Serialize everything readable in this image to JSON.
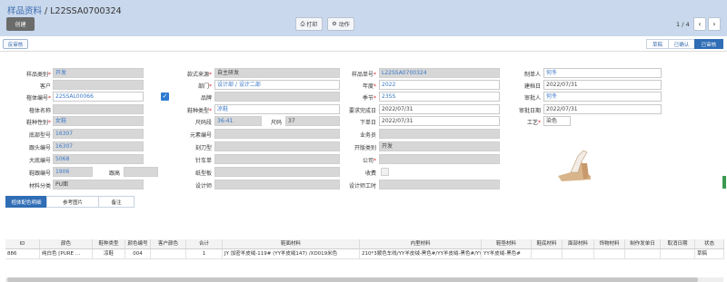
{
  "header": {
    "crumb_link": "样品资料",
    "crumb_sep": " / ",
    "record_no": "L22SSA0700324",
    "create_label": "创建",
    "print_label": "打印",
    "action_label": "动作",
    "pager_text": "1 / 4",
    "prev": "‹",
    "next": "›"
  },
  "status": {
    "unaudit_label": "反审核",
    "steps": [
      "草稿",
      "已确认",
      "已审核"
    ],
    "active_step": "已审核"
  },
  "form": {
    "col1": [
      {
        "label": "样品类别",
        "req": "*",
        "value": "开发"
      },
      {
        "label": "客户",
        "req": "",
        "value": ""
      },
      {
        "label": "楦体编号",
        "req": "*",
        "value": "22SSAL00066"
      },
      {
        "label": "楦体名称",
        "req": "",
        "value": ""
      },
      {
        "label": "鞋种性别",
        "req": "*",
        "value": "女鞋"
      },
      {
        "label": "底部型号",
        "req": "",
        "value": "16307"
      },
      {
        "label": "跟头编号",
        "req": "",
        "value": "16307"
      },
      {
        "label": "大底编号",
        "req": "",
        "value": "5068"
      },
      {
        "label": "鞋跟编号",
        "req": "",
        "value": "1906"
      },
      {
        "label": "材料分类",
        "req": "",
        "value": "PU面"
      }
    ],
    "col1_extra": {
      "label": "跟高",
      "value": ""
    },
    "col2": [
      {
        "label": "款式来源",
        "req": "*",
        "value": "自主研发"
      },
      {
        "label": "部门",
        "req": "*",
        "value": "设计部 / 设计二部"
      },
      {
        "label": "品牌",
        "req": "",
        "value": ""
      },
      {
        "label": "鞋种类型",
        "req": "*",
        "value": "凉鞋"
      },
      {
        "label": "尺码段",
        "req": "",
        "value": "36-41"
      },
      {
        "label": "元素编号",
        "req": "",
        "value": ""
      },
      {
        "label": "刻刀型",
        "req": "",
        "value": ""
      },
      {
        "label": "针车单",
        "req": "",
        "value": ""
      },
      {
        "label": "纸型板",
        "req": "",
        "value": ""
      },
      {
        "label": "设计师",
        "req": "",
        "value": ""
      }
    ],
    "col2_extra": {
      "label": "尺码",
      "value": "37"
    },
    "col3": [
      {
        "label": "样品单号",
        "req": "*",
        "value": "L22SSA0700324"
      },
      {
        "label": "年度",
        "req": "*",
        "value": "2022"
      },
      {
        "label": "季节",
        "req": "*",
        "value": "23SS"
      },
      {
        "label": "要求完成日",
        "req": "",
        "value": "2022/07/31"
      },
      {
        "label": "下单日",
        "req": "",
        "value": "2022/07/31"
      },
      {
        "label": "业务员",
        "req": "",
        "value": ""
      },
      {
        "label": "开版类别",
        "req": "",
        "value": "开发"
      },
      {
        "label": "公司",
        "req": "*",
        "value": ""
      },
      {
        "label": "收费",
        "req": "",
        "value": ""
      },
      {
        "label": "设计师工时",
        "req": "",
        "value": ""
      }
    ],
    "col4": [
      {
        "label": "制单人",
        "req": "",
        "value": "何冬"
      },
      {
        "label": "建档日",
        "req": "",
        "value": "2022/07/31"
      },
      {
        "label": "审批人",
        "req": "",
        "value": "何冬"
      },
      {
        "label": "审批日期",
        "req": "",
        "value": "2022/07/31"
      },
      {
        "label": "工艺",
        "req": "*",
        "value": "染色"
      }
    ]
  },
  "tabs": [
    "楦体配色明细",
    "参考图片",
    "备注"
  ],
  "grid": {
    "columns": [
      "ID",
      "颜色",
      "鞋种类型",
      "颜色编号",
      "客户颜色",
      "合计",
      "鞋面材料",
      "内里材料",
      "鞋垫材料",
      "鞋底材料",
      "面部材料",
      "饰物材料",
      "制作发单日",
      "取消日期",
      "状态"
    ],
    "rows": [
      [
        "886",
        "纯白色 [PURE …",
        "凉鞋",
        "004",
        "",
        "1",
        "JY 加密羊皮绒-119# (YY羊皮绒147) /XD019米色",
        "210*3顺色车线/YY羊皮绒-黑色#/YY羊皮绒-黑色#/YY羊皮绒-黑色#",
        "YY羊皮绒-黑色#",
        "",
        "",
        "",
        "",
        "",
        "草稿"
      ]
    ]
  },
  "colors": {
    "accent": "#2f6db5",
    "required": "#d9312b",
    "link": "#3a78c8"
  }
}
